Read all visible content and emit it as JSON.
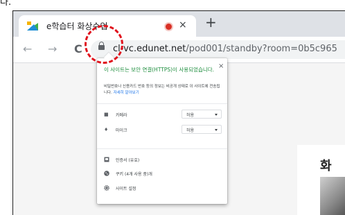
{
  "top_text": "다.",
  "tab": {
    "title": "e학습터 화상수업",
    "close_label": "×"
  },
  "new_tab_label": "+",
  "nav": {
    "back": "←",
    "forward": "→",
    "reload": "C"
  },
  "url": {
    "host": "cl-vc.edunet.net",
    "path": "/pod001/standby?room=0b5c965"
  },
  "popup": {
    "close_label": "×",
    "heading": "이 사이트는 보안 연결(HTTPS)이 사용되었습니다.",
    "description": "비밀번호나 신용카드 번호 등의 정보는 비공개 상태로 이 사이트에 전송됩니다.",
    "learn_more": "자세히 알아보기",
    "permissions": [
      {
        "icon": "camera-icon",
        "label": "카메라",
        "value": "허용"
      },
      {
        "icon": "microphone-icon",
        "label": "마이크",
        "value": "허용"
      }
    ],
    "items": [
      {
        "icon": "certificate-icon",
        "label": "인증서 (유효)"
      },
      {
        "icon": "cookie-icon",
        "label": "쿠키 (4개 사용 중)개"
      },
      {
        "icon": "settings-icon",
        "label": "사이트 설정"
      }
    ]
  },
  "page": {
    "card_heading": "화"
  },
  "colors": {
    "accent": "#1a73e8",
    "secure_green": "#1e8e3e",
    "annotation_red": "#e0121c"
  }
}
